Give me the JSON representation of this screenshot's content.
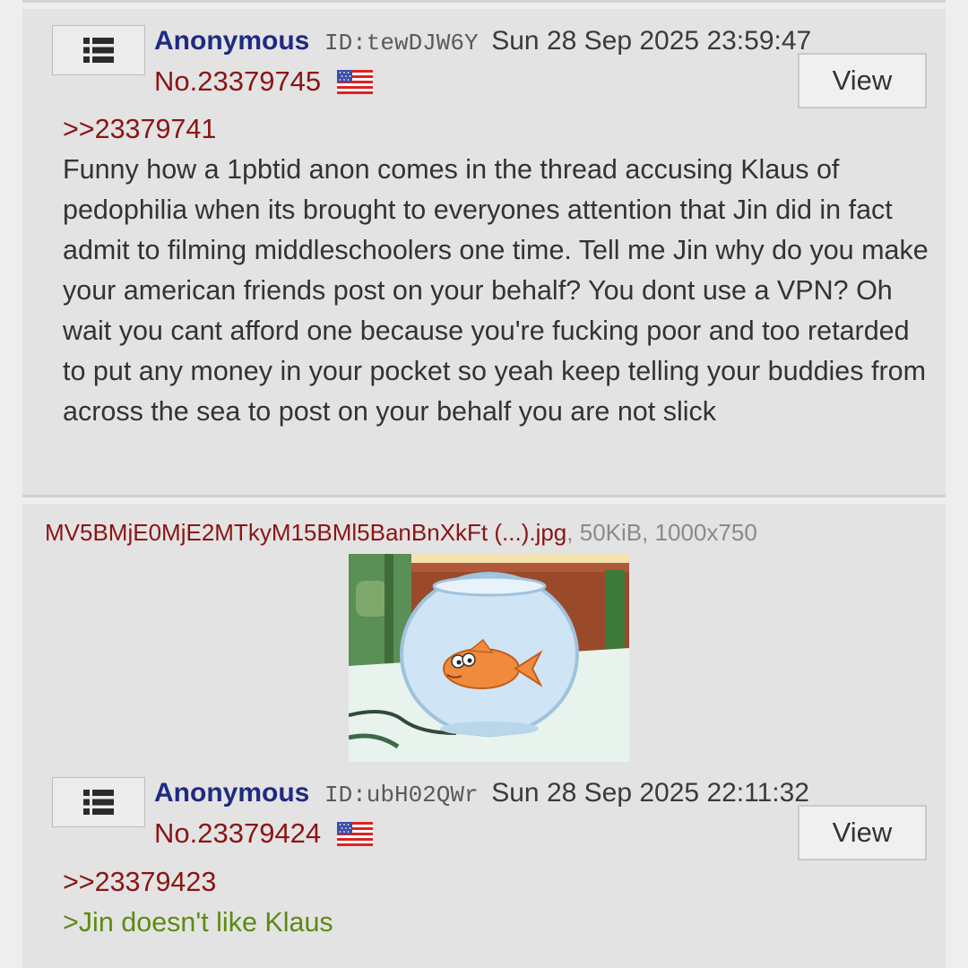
{
  "posts": [
    {
      "name": "Anonymous",
      "poster_id": "ID:tewDJW6Y",
      "date": "Sun 28 Sep 2025 23:59:47",
      "post_number": "No.23379745",
      "flag_icon": "us-flag-icon",
      "menu_icon": "list-menu-icon",
      "view_label": "View",
      "quote": ">>23379741",
      "message": "Funny how a 1pbtid anon comes in the thread accusing Klaus of pedophilia when its brought to everyones attention that Jin did in fact admit to filming middleschoolers one time. Tell me Jin why do you make your american friends post on your behalf? You dont use a VPN? Oh wait you cant afford one because you're fucking poor and too retarded to put any money in your pocket so yeah keep telling your buddies from across the sea to post on your behalf you are not slick"
    },
    {
      "file": {
        "name": "MV5BMjE0MjE2MTkyM15BMl5BanBnXkFt (...).jpg",
        "meta": ", 50KiB, 1000x750",
        "thumbnail_icon": "goldfish-bowl-thumbnail"
      },
      "name": "Anonymous",
      "poster_id": "ID:ubH02QWr",
      "date": "Sun 28 Sep 2025 22:11:32",
      "post_number": "No.23379424",
      "flag_icon": "us-flag-icon",
      "menu_icon": "list-menu-icon",
      "view_label": "View",
      "quote": ">>23379423",
      "greentext": ">Jin doesn't like Klaus"
    }
  ],
  "colors": {
    "name": "#1f2a80",
    "post_number": "#8b1414",
    "quote": "#8b1414",
    "greentext": "#5d8a12",
    "post_background": "#e3e3e3",
    "page_background": "#eeeeee"
  }
}
